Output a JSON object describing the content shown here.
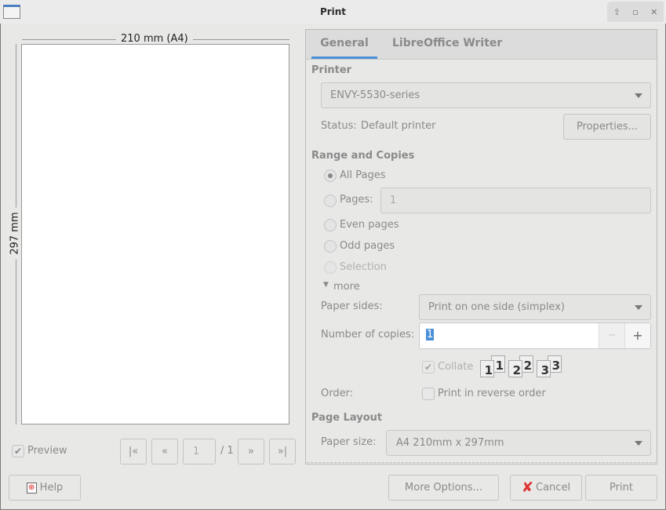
{
  "window": {
    "title": "Print"
  },
  "preview": {
    "width_label": "210 mm (A4)",
    "height_label": "297 mm",
    "preview_label": "Preview",
    "preview_checked": true,
    "current_page": "1",
    "total_pages": "/ 1"
  },
  "tabs": [
    {
      "label": "General",
      "active": true
    },
    {
      "label": "LibreOffice Writer",
      "active": false
    }
  ],
  "printer": {
    "heading": "Printer",
    "selected": "ENVY-5530-series",
    "status_label": "Status:",
    "status_value": "Default printer",
    "properties_label": "Properties..."
  },
  "range": {
    "heading": "Range and Copies",
    "all_pages": "All Pages",
    "pages": "Pages:",
    "pages_value": "1",
    "even_pages": "Even pages",
    "odd_pages": "Odd pages",
    "selection": "Selection",
    "more": "more",
    "paper_sides_label": "Paper sides:",
    "paper_sides_value": "Print on one side (simplex)",
    "copies_label": "Number of copies:",
    "copies_value": "1",
    "collate": "Collate",
    "collate_checked": true,
    "order_label": "Order:",
    "reverse_label": "Print in reverse order",
    "reverse_checked": false,
    "collate_pages": [
      "1",
      "1",
      "2",
      "2",
      "3",
      "3"
    ]
  },
  "layout": {
    "heading": "Page Layout",
    "paper_size_label": "Paper size:",
    "paper_size_value": "A4 210mm x 297mm"
  },
  "buttons": {
    "help": "Help",
    "more_options": "More Options...",
    "cancel": "Cancel",
    "print": "Print"
  },
  "colors": {
    "accent": "#4a90d9",
    "selection": "#4a90d9"
  }
}
